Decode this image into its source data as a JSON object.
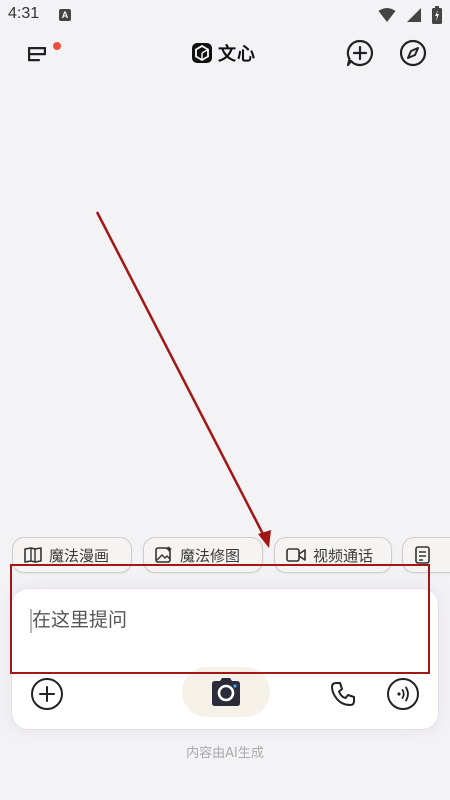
{
  "status_bar": {
    "time": "4:31",
    "indicator_letter": "A",
    "icons": [
      "wifi-icon",
      "signal-icon",
      "battery-icon"
    ]
  },
  "header": {
    "title": "文心",
    "menu_icon": "menu-list-icon",
    "notification_dot_color": "#f04c3e",
    "new_chat_icon": "chat-plus-icon",
    "discover_icon": "compass-icon"
  },
  "chips": [
    {
      "label": "魔法漫画",
      "icon": "comic-book-icon"
    },
    {
      "label": "魔法修图",
      "icon": "image-edit-icon"
    },
    {
      "label": "视频通话",
      "icon": "video-camera-icon"
    },
    {
      "label": "",
      "icon": "document-icon"
    }
  ],
  "composer": {
    "placeholder": "在这里提问",
    "add_icon": "plus-circle-icon",
    "camera_icon": "camera-icon",
    "phone_icon": "phone-icon",
    "voice_icon": "voice-wave-icon"
  },
  "footer": {
    "note": "内容由AI生成"
  },
  "colors": {
    "annotation_red": "#a31616",
    "background": "#f3f3f5",
    "brand_dark": "#111111"
  }
}
